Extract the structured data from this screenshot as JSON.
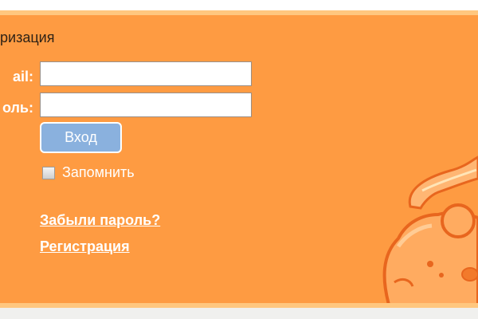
{
  "login": {
    "title": "ризация",
    "email_label": "ail:",
    "email_value": "",
    "password_label": "оль:",
    "password_value": "",
    "submit_label": "Вход",
    "remember_label": "Запомнить",
    "remember_checked": false,
    "forgot_link": "Забыли пароль?",
    "register_link": "Регистрация"
  },
  "colors": {
    "panel": "#fe9b42",
    "panel_border": "#ffc77f",
    "button": "#8ab1de",
    "text_light": "#ffffff"
  },
  "icons": {
    "mascot": "orange-creature-illustration"
  }
}
